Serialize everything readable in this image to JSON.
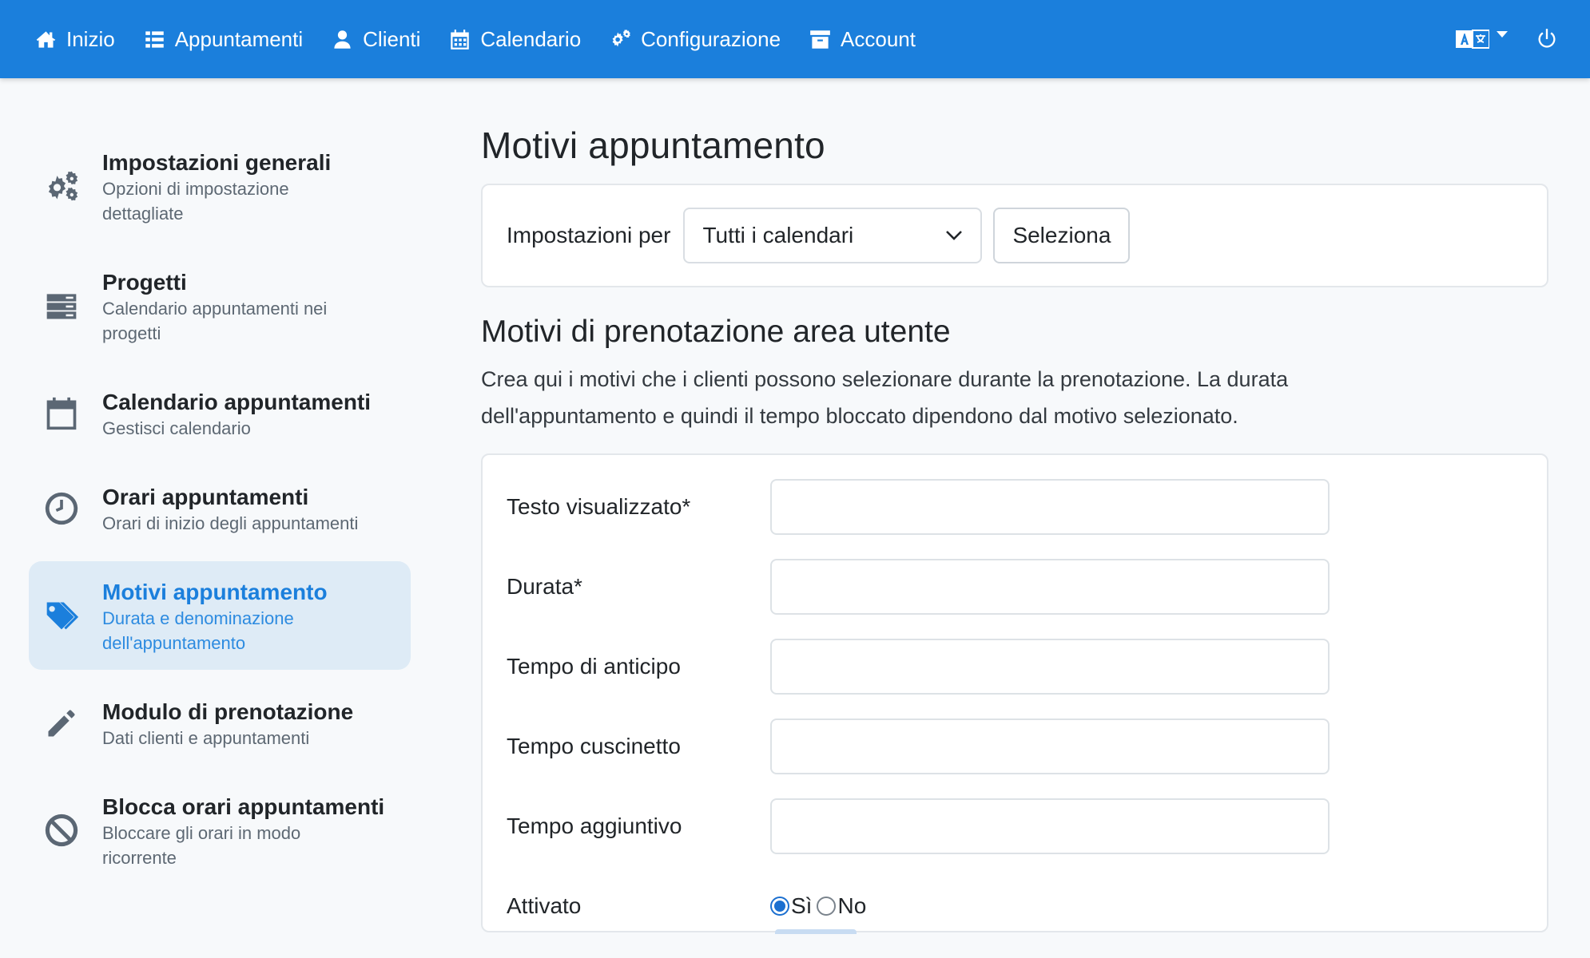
{
  "navbar": {
    "items": [
      {
        "label": "Inizio",
        "icon": "home-icon"
      },
      {
        "label": "Appuntamenti",
        "icon": "list-icon"
      },
      {
        "label": "Clienti",
        "icon": "user-icon"
      },
      {
        "label": "Calendario",
        "icon": "calendar-icon"
      },
      {
        "label": "Configurazione",
        "icon": "gears-icon"
      },
      {
        "label": "Account",
        "icon": "archive-icon"
      }
    ],
    "language_icon": "language-icon",
    "power_icon": "power-icon",
    "background_color": "#1b7fdc"
  },
  "sidebar": {
    "items": [
      {
        "title": "Impostazioni generali",
        "subtitle": "Opzioni di impostazione dettagliate",
        "icon": "gears-icon",
        "active": false
      },
      {
        "title": "Progetti",
        "subtitle": "Calendario appuntamenti nei progetti",
        "icon": "server-icon",
        "active": false
      },
      {
        "title": "Calendario appuntamenti",
        "subtitle": "Gestisci calendario",
        "icon": "calendar-icon",
        "active": false
      },
      {
        "title": "Orari appuntamenti",
        "subtitle": "Orari di inizio degli appuntamenti",
        "icon": "clock-icon",
        "active": false
      },
      {
        "title": "Motivi appuntamento",
        "subtitle": "Durata e denominazione dell'appuntamento",
        "icon": "tags-icon",
        "active": true
      },
      {
        "title": "Modulo di prenotazione",
        "subtitle": "Dati clienti e appuntamenti",
        "icon": "pencil-icon",
        "active": false
      },
      {
        "title": "Blocca orari appuntamenti",
        "subtitle": "Bloccare gli orari in modo ricorrente",
        "icon": "ban-icon",
        "active": false
      }
    ],
    "active_color": "#1b7fdc"
  },
  "main": {
    "page_title": "Motivi appuntamento",
    "settings": {
      "label": "Impostazioni per",
      "select_value": "Tutti i calendari",
      "select_button": "Seleziona"
    },
    "section_title": "Motivi di prenotazione area utente",
    "description": "Crea qui i motivi che i clienti possono selezionare durante la prenotazione. La durata dell'appuntamento e quindi il tempo bloccato dipendono dal motivo selezionato.",
    "form": {
      "fields": [
        {
          "label": "Testo visualizzato*",
          "value": ""
        },
        {
          "label": "Durata*",
          "value": ""
        },
        {
          "label": "Tempo di anticipo",
          "value": ""
        },
        {
          "label": "Tempo cuscinetto",
          "value": ""
        },
        {
          "label": "Tempo aggiuntivo",
          "value": ""
        }
      ],
      "enabled": {
        "label": "Attivato",
        "option_yes": "Sì",
        "option_no": "No",
        "selected": "Sì"
      }
    }
  }
}
